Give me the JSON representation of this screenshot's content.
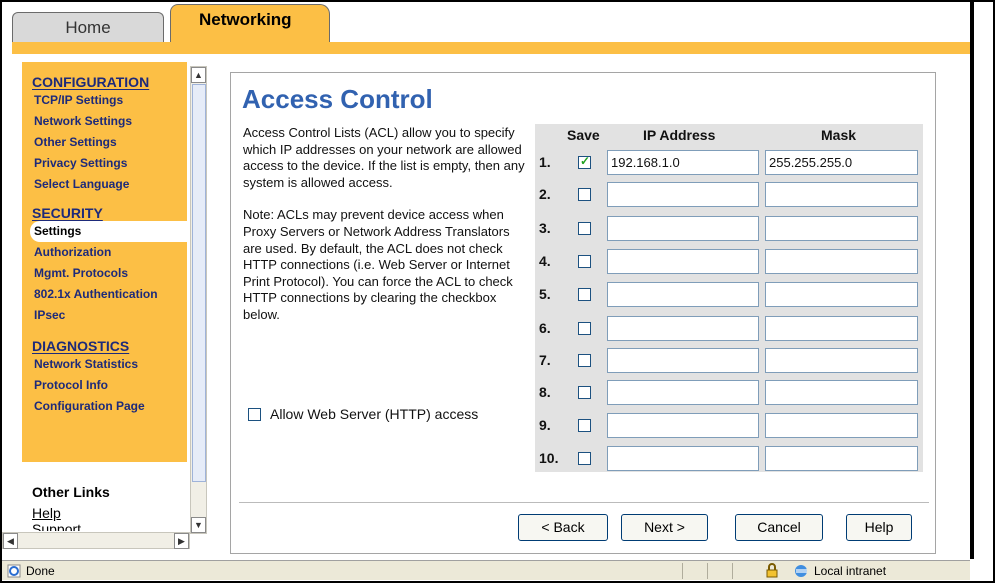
{
  "tabs": {
    "home": "Home",
    "networking": "Networking"
  },
  "sidebar": {
    "configuration": {
      "heading": "CONFIGURATION",
      "items": [
        "TCP/IP Settings",
        "Network Settings",
        "Other Settings",
        "Privacy Settings",
        "Select Language"
      ]
    },
    "security": {
      "heading": "SECURITY",
      "items": [
        "Settings",
        "Authorization",
        "Mgmt. Protocols",
        "802.1x Authentication",
        "IPsec"
      ],
      "active": "Settings"
    },
    "diagnostics": {
      "heading": "DIAGNOSTICS",
      "items": [
        "Network Statistics",
        "Protocol Info",
        "Configuration Page"
      ]
    },
    "other_links": {
      "heading": "Other Links",
      "help": "Help",
      "support": "Support"
    }
  },
  "page": {
    "title": "Access Control",
    "description": "Access Control Lists (ACL) allow you to specify which IP addresses on your network are allowed access to the device. If the list is empty, then any system is allowed access.",
    "note": "Note: ACLs may prevent device access when Proxy Servers or Network Address Translators are used. By default, the ACL does not check HTTP connections (i.e. Web Server or Internet Print Protocol). You can force the ACL to check HTTP connections by clearing the checkbox below.",
    "allow_http_label": "Allow Web Server (HTTP) access",
    "allow_http_checked": false
  },
  "acl_table": {
    "headers": {
      "save": "Save",
      "ip": "IP Address",
      "mask": "Mask"
    },
    "rows": [
      {
        "num": "1.",
        "save": true,
        "ip": "192.168.1.0",
        "mask": "255.255.255.0"
      },
      {
        "num": "2.",
        "save": false,
        "ip": "",
        "mask": ""
      },
      {
        "num": "3.",
        "save": false,
        "ip": "",
        "mask": ""
      },
      {
        "num": "4.",
        "save": false,
        "ip": "",
        "mask": ""
      },
      {
        "num": "5.",
        "save": false,
        "ip": "",
        "mask": ""
      },
      {
        "num": "6.",
        "save": false,
        "ip": "",
        "mask": ""
      },
      {
        "num": "7.",
        "save": false,
        "ip": "",
        "mask": ""
      },
      {
        "num": "8.",
        "save": false,
        "ip": "",
        "mask": ""
      },
      {
        "num": "9.",
        "save": false,
        "ip": "",
        "mask": ""
      },
      {
        "num": "10.",
        "save": false,
        "ip": "",
        "mask": ""
      }
    ]
  },
  "buttons": {
    "back": "< Back",
    "next": "Next >",
    "cancel": "Cancel",
    "help": "Help"
  },
  "statusbar": {
    "status": "Done",
    "zone": "Local intranet"
  },
  "colors": {
    "tab_active": "#fcbf45",
    "title": "#3162b0",
    "nav_link": "#1d2a7a"
  }
}
